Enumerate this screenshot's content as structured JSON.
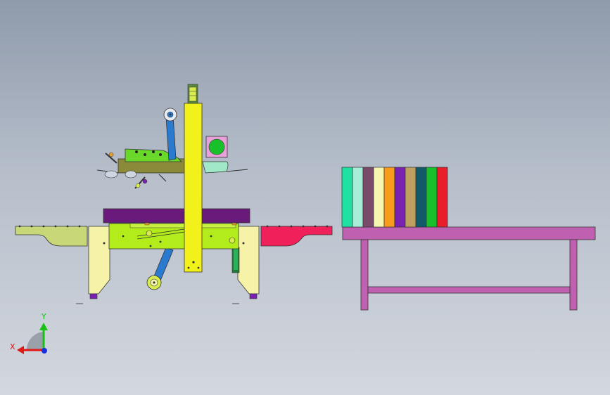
{
  "scene": {
    "background_top": "#8f9aab",
    "background_bottom": "#d3d7de"
  },
  "colors": {
    "yellow_column": "#f2f21a",
    "lime_frame": "#b2ec1a",
    "olive_head": "#8a8a3a",
    "purple_plate": "#6a1a7a",
    "pale_leg": "#f6f2a8",
    "sage_conveyor": "#c8d878",
    "red_conveyor": "#f0205a",
    "magenta_table": "#c060b0",
    "blue_arm": "#2a7ad0",
    "teal_box": "#a0e8c8",
    "green_green": "#22c832"
  },
  "box_stack": [
    {
      "color": "#1ee0a0"
    },
    {
      "color": "#a6ecd8"
    },
    {
      "color": "#7a4a6a"
    },
    {
      "color": "#f6f6b0"
    },
    {
      "color": "#f89a1a"
    },
    {
      "color": "#7a22b0"
    },
    {
      "color": "#c0a060"
    },
    {
      "color": "#125a6a"
    },
    {
      "color": "#18c02a"
    },
    {
      "color": "#e81e2a"
    }
  ],
  "triad": {
    "x_label": "X",
    "y_label": "Y",
    "x_color": "#e01818",
    "y_color": "#18c018",
    "z_color": "#1830e0"
  }
}
